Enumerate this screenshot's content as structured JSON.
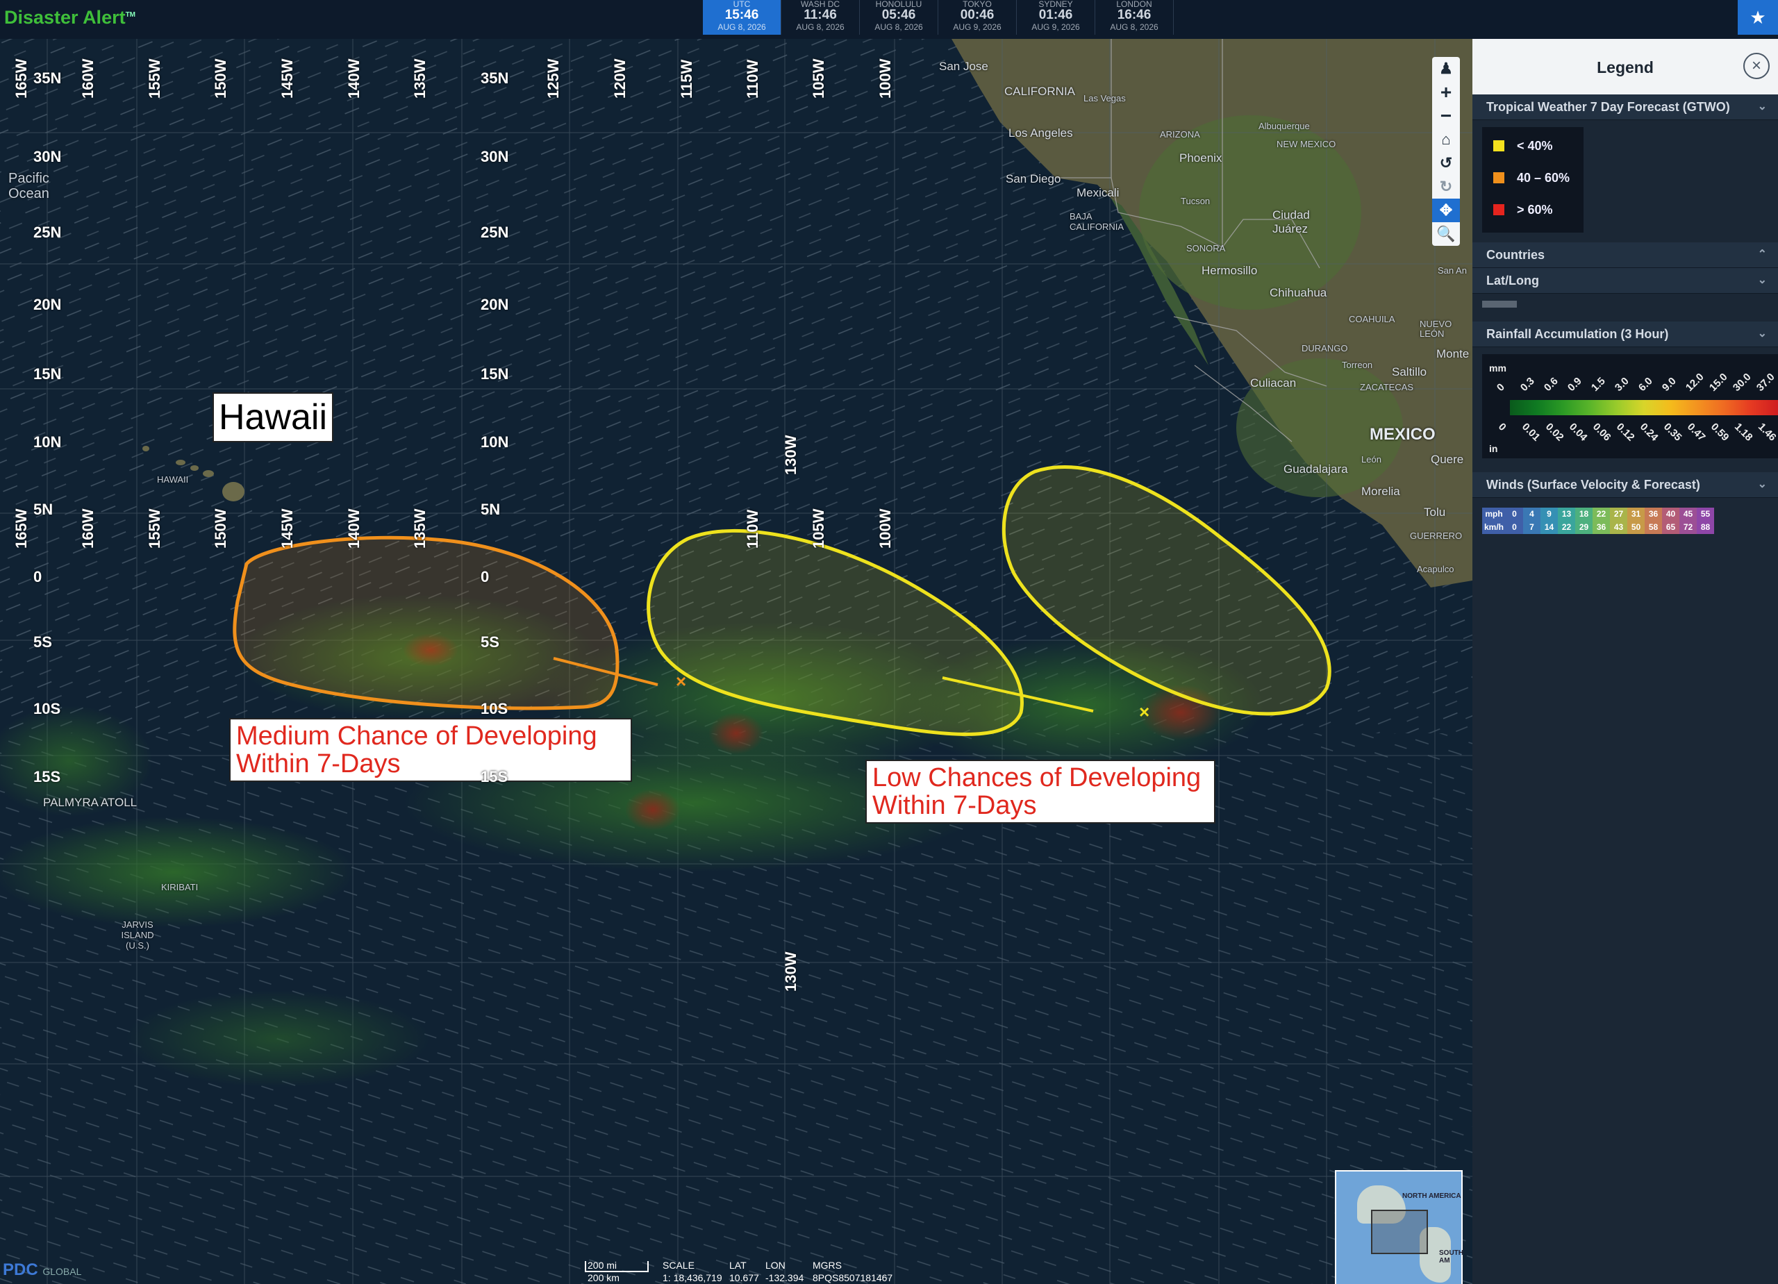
{
  "app": {
    "title": "Disaster Alert",
    "tm": "TM"
  },
  "clocks": [
    {
      "label": "UTC",
      "time": "15:46",
      "date": "AUG 8, 2026",
      "active": true
    },
    {
      "label": "WASH DC",
      "time": "11:46",
      "date": "AUG 8, 2026"
    },
    {
      "label": "HONOLULU",
      "time": "05:46",
      "date": "AUG 8, 2026"
    },
    {
      "label": "TOKYO",
      "time": "00:46",
      "date": "AUG 9, 2026"
    },
    {
      "label": "SYDNEY",
      "time": "01:46",
      "date": "AUG 9, 2026"
    },
    {
      "label": "LONDON",
      "time": "16:46",
      "date": "AUG 8, 2026"
    }
  ],
  "map": {
    "lat_labels_left": [
      "35N",
      "30N",
      "25N",
      "20N",
      "15N",
      "10N",
      "5N",
      "0",
      "5S",
      "10S",
      "15S"
    ],
    "lat_labels_mid": [
      "35N",
      "30N",
      "25N",
      "20N",
      "15N",
      "10N",
      "5N",
      "0",
      "5S",
      "10S",
      "15S"
    ],
    "lon_labels": [
      "165W",
      "160W",
      "155W",
      "150W",
      "145W",
      "140W",
      "135W",
      "130W",
      "125W",
      "120W",
      "115W",
      "110W",
      "105W",
      "100W"
    ],
    "lon_labels_bottom": [
      "165W",
      "160W",
      "155W",
      "150W",
      "145W",
      "140W",
      "135W",
      "130W",
      "110W",
      "105W",
      "100W"
    ],
    "places": {
      "pacific_ocean": "Pacific Ocean",
      "hawaii_small": "HAWAII",
      "palmyra": "PALMYRA ATOLL",
      "kiribati": "KIRIBATI",
      "jarvis": "JARVIS ISLAND (U.S.)",
      "san_jose": "San Jose",
      "california": "CALIFORNIA",
      "las_vegas": "Las Vegas",
      "los_angeles": "Los Angeles",
      "san_diego": "San Diego",
      "mexicali": "Mexicali",
      "baja": "BAJA CALIFORNIA",
      "arizona": "ARIZONA",
      "phoenix": "Phoenix",
      "tucson": "Tucson",
      "albuquerque": "Albuquerque",
      "new_mexico": "NEW MEXICO",
      "ciudad_juarez": "Ciudad Juárez",
      "sonora": "SONORA",
      "hermosillo": "Hermosillo",
      "chihuahua": "Chihuahua",
      "coahuila": "COAHUILA",
      "durango": "DURANGO",
      "torreon": "Torreon",
      "saltillo": "Saltillo",
      "monterrey": "Monte",
      "culiacan": "Culiacan",
      "zacatecas": "ZACATECAS",
      "mexico": "MEXICO",
      "guadalajara": "Guadalajara",
      "leon": "León",
      "queretaro": "Quere",
      "morelia": "Morelia",
      "toluca": "Tolu",
      "acapulco": "Acapulco",
      "guerrero": "GUERRERO",
      "san_antonio": "San An",
      "nuevo_leon": "NUEVO LEÓN"
    },
    "hawaii_box": "Hawaii",
    "callout_medium": [
      "Medium Chance of Developing",
      "Within 7-Days"
    ],
    "callout_low": [
      "Low Chances of Developing",
      "Within 7-Days"
    ],
    "outlooks": [
      {
        "name": "Medium",
        "chance": "40 – 60%",
        "color": "#f0901c"
      },
      {
        "name": "Low west",
        "chance": "< 40%",
        "color": "#eee21e"
      },
      {
        "name": "Low east",
        "chance": "< 40%",
        "color": "#eee21e"
      }
    ]
  },
  "minimap": {
    "label1": "NORTH AMERICA",
    "label2": "SOUTH AM"
  },
  "footer": {
    "logo": "PDC",
    "logo_suffix": "GLOBAL",
    "scale_mi": "200 mi",
    "scale_km": "200 km",
    "scale_label": "SCALE",
    "scale_value": "1: 18,436,719",
    "lat_label": "LAT",
    "lat_value": "10.677",
    "lon_label": "LON",
    "lon_value": "-132.394",
    "mgrs_label": "MGRS",
    "mgrs_value": "8PQS8507181467"
  },
  "legend": {
    "title": "Legend",
    "gtwo_title": "Tropical Weather 7 Day Forecast (GTWO)",
    "gtwo_items": [
      {
        "label": "< 40%",
        "color": "#f5e11e"
      },
      {
        "label": "40 – 60%",
        "color": "#f0901c"
      },
      {
        "label": "> 60%",
        "color": "#e5241e"
      }
    ],
    "countries": "Countries",
    "latlong": "Lat/Long",
    "rain_title": "Rainfall Accumulation (3 Hour)",
    "rain_mm_label": "mm",
    "rain_in_label": "in",
    "rain_mm": [
      "0",
      "0.3",
      "0.6",
      "0.9",
      "1.5",
      "3.0",
      "6.0",
      "9.0",
      "12.0",
      "15.0",
      "30.0",
      "37.0"
    ],
    "rain_in": [
      "0",
      "0.01",
      "0.02",
      "0.04",
      "0.06",
      "0.12",
      "0.24",
      "0.35",
      "0.47",
      "0.59",
      "1.18",
      "1.46"
    ],
    "winds_title": "Winds (Surface Velocity & Forecast)",
    "winds_mph_label": "mph",
    "winds_kmh_label": "km/h",
    "winds_mph": [
      "0",
      "4",
      "9",
      "13",
      "18",
      "22",
      "27",
      "31",
      "36",
      "40",
      "45",
      "55"
    ],
    "winds_kmh": [
      "0",
      "7",
      "14",
      "22",
      "29",
      "36",
      "43",
      "50",
      "58",
      "65",
      "72",
      "88"
    ],
    "winds_colors": [
      "#3f5fa8",
      "#3a78b4",
      "#3590b4",
      "#3aa59c",
      "#4db07e",
      "#7cbb5a",
      "#a9b44a",
      "#c79a48",
      "#c77a55",
      "#b35c76",
      "#9c4f95",
      "#8e46a8"
    ]
  }
}
